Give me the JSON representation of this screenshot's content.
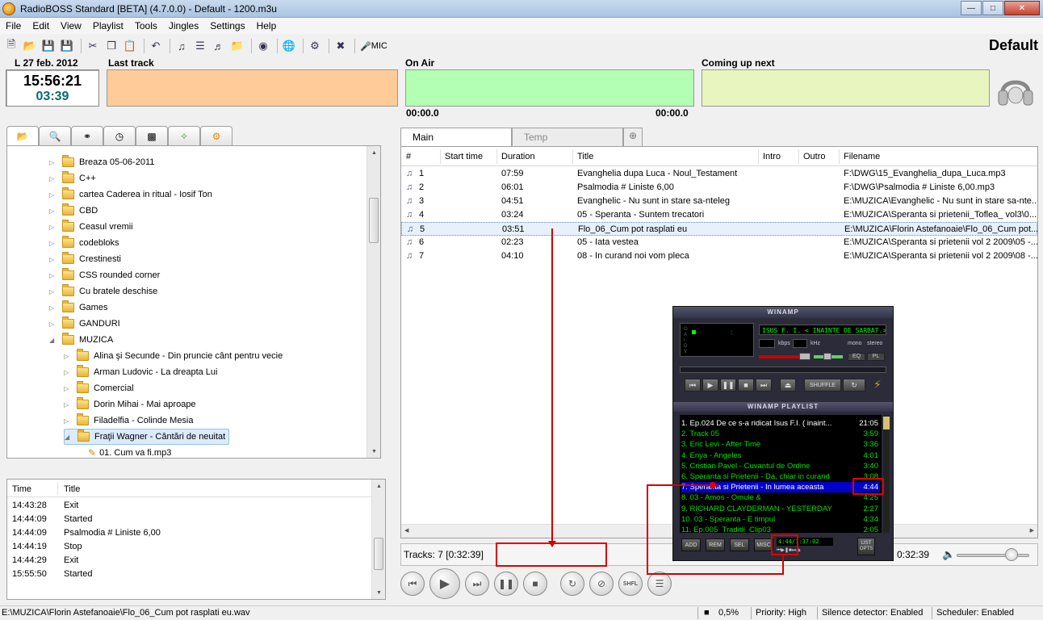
{
  "window": {
    "title": "RadioBOSS Standard [BETA] (4.7.0.0) - Default - 1200.m3u"
  },
  "menu": [
    "File",
    "Edit",
    "View",
    "Playlist",
    "Tools",
    "Jingles",
    "Settings",
    "Help"
  ],
  "toolbar": {
    "mic_label": "MIC",
    "profile": "Default"
  },
  "info": {
    "date": "L 27 feb. 2012",
    "clock": "15:56:21",
    "remaining": "03:39",
    "last_track_label": "Last track",
    "on_air_label": "On Air",
    "coming_up_label": "Coming up next",
    "on_air_time": "00:00.0",
    "coming_time": "00:00.0",
    "colors": {
      "last_track": "#ffcc99",
      "on_air": "#b3ffb3",
      "coming_up": "#e9f5be"
    }
  },
  "tree": [
    {
      "label": "Breaza 05-06-2011",
      "level": 0
    },
    {
      "label": "C++",
      "level": 0
    },
    {
      "label": "cartea Caderea in ritual - Iosif Ton",
      "level": 0
    },
    {
      "label": "CBD",
      "level": 0
    },
    {
      "label": "Ceasul vremii",
      "level": 0
    },
    {
      "label": "codebloks",
      "level": 0
    },
    {
      "label": "Crestinesti",
      "level": 0
    },
    {
      "label": "CSS rounded corner",
      "level": 0
    },
    {
      "label": "Cu bratele deschise",
      "level": 0
    },
    {
      "label": "Games",
      "level": 0
    },
    {
      "label": "GANDURI",
      "level": 0
    },
    {
      "label": "MUZICA",
      "level": 0
    },
    {
      "label": "Alina şi Secunde - Din pruncie cânt pentru vecie",
      "level": 1
    },
    {
      "label": "Arman Ludovic - La dreapta Lui",
      "level": 1
    },
    {
      "label": "Comercial",
      "level": 1
    },
    {
      "label": "Dorin Mihai - Mai aproape",
      "level": 1
    },
    {
      "label": "Filadelfia - Colinde Mesia",
      "level": 1
    },
    {
      "label": "Fraţii Wagner - Cântări de neuitat",
      "level": 1
    },
    {
      "label": "01. Cum va fi.mp3",
      "level": 2
    }
  ],
  "log": {
    "headers": [
      "Time",
      "Title"
    ],
    "rows": [
      [
        "14:43:28",
        "Exit"
      ],
      [
        "14:44:09",
        "Started"
      ],
      [
        "14:44:09",
        "Psalmodia # Liniste   6,00"
      ],
      [
        "14:44:19",
        "Stop"
      ],
      [
        "14:44:29",
        "Exit"
      ],
      [
        "15:55:50",
        "Started"
      ]
    ]
  },
  "playlist": {
    "tabs": [
      "Main",
      "Temp"
    ],
    "headers": [
      "#",
      "Start time",
      "Duration",
      "Title",
      "Intro",
      "Outro",
      "Filename"
    ],
    "rows": [
      [
        "1",
        "",
        "07:59",
        "Evanghelia dupa Luca - Noul_Testament",
        "",
        "",
        "F:\\DWG\\15_Evanghelia_dupa_Luca.mp3"
      ],
      [
        "2",
        "",
        "06:01",
        "Psalmodia # Liniste   6,00",
        "",
        "",
        "F:\\DWG\\Psalmodia # Liniste   6,00.mp3"
      ],
      [
        "3",
        "",
        "04:51",
        "Evanghelic - Nu sunt in stare sa-nteleg",
        "",
        "",
        "E:\\MUZICA\\Evanghelic - Nu sunt in stare sa-nte..."
      ],
      [
        "4",
        "",
        "03:24",
        "05 - Speranta - Suntem trecatori",
        "",
        "",
        "E:\\MUZICA\\Speranta si prietenii_Toflea_ vol3\\0..."
      ],
      [
        "5",
        "",
        "03:51",
        "Flo_06_Cum pot rasplati eu",
        "",
        "",
        "E:\\MUZICA\\Florin Astefanoaie\\Flo_06_Cum pot..."
      ],
      [
        "6",
        "",
        "02:23",
        "05 - Iata vestea",
        "",
        "",
        "E:\\MUZICA\\Speranta si prietenii vol 2 2009\\05 -..."
      ],
      [
        "7",
        "",
        "04:10",
        "08 - In curand noi vom pleca",
        "",
        "",
        "E:\\MUZICA\\Speranta si prietenii vol 2 2009\\08 -..."
      ]
    ],
    "selected_index": 4,
    "tracks": "Tracks: 7 [0:32:39]",
    "remaining": "0:32:39"
  },
  "transport": {
    "shfl": "SHFL"
  },
  "winamp": {
    "title": "WINAMP",
    "song": "ISUS F. I. < INAINTE DE SARBAT.>",
    "kbps": "kbps",
    "khz": "kHz",
    "mono": "mono",
    "stereo": "stereo",
    "eq": "EQ",
    "pl": "PL",
    "shuffle": "SHUFFLE",
    "playlist_title": "WINAMP PLAYLIST",
    "items": [
      [
        "1. Ep.024 De ce s-a ridicat Isus F.I. ( inaint...",
        "21:05"
      ],
      [
        "2. Track 05",
        "3:59"
      ],
      [
        "3. Eric Levi - After Time",
        "3:36"
      ],
      [
        "4. Enya - Angeles",
        "4:01"
      ],
      [
        "5. Cristian Pavel - Cuvantul de Ordine",
        "3:40"
      ],
      [
        "6. Speranta si Prietenii - Da, chiar in curand",
        "3:08"
      ],
      [
        "7. Speranta si Prietenii - In lumea aceasta",
        "4:44"
      ],
      [
        "8. 03 - Amos - Omule &",
        "4:25"
      ],
      [
        "9. RICHARD CLAYDERMAN - YESTERDAY",
        "2:27"
      ],
      [
        "10. 03 - Speranta - E timpul",
        "4:34"
      ],
      [
        "11. Ep.005_Traditii_Clip03",
        "2:05"
      ]
    ],
    "current_index": 6,
    "buttons": [
      "ADD",
      "REM",
      "SEL",
      "MISC"
    ],
    "list_opts": "LIST OPTS",
    "time_display": "4:44/1:37:02"
  },
  "status": {
    "path": "E:\\MUZICA\\Florin Astefanoaie\\Flo_06_Cum pot rasplati eu.wav",
    "cpu": "0,5%",
    "priority": "Priority: High",
    "silence": "Silence detector: Enabled",
    "scheduler": "Scheduler: Enabled"
  }
}
